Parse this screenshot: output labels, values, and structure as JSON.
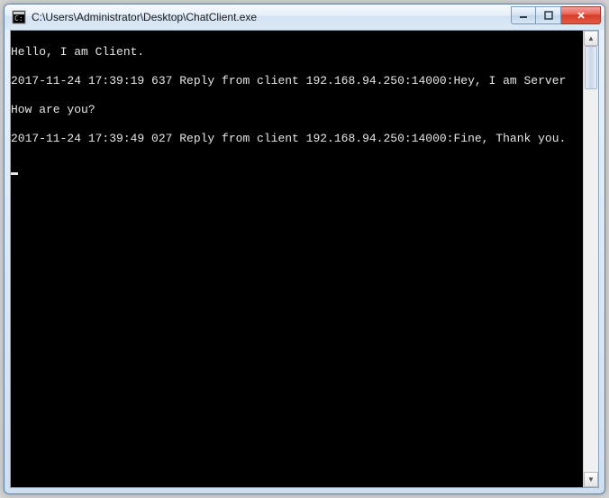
{
  "window": {
    "title": "C:\\Users\\Administrator\\Desktop\\ChatClient.exe"
  },
  "console": {
    "lines": [
      "Hello, I am Client.",
      "2017-11-24 17:39:19 637 Reply from client 192.168.94.250:14000:Hey, I am Server",
      "How are you?",
      "2017-11-24 17:39:49 027 Reply from client 192.168.94.250:14000:Fine, Thank you."
    ]
  }
}
